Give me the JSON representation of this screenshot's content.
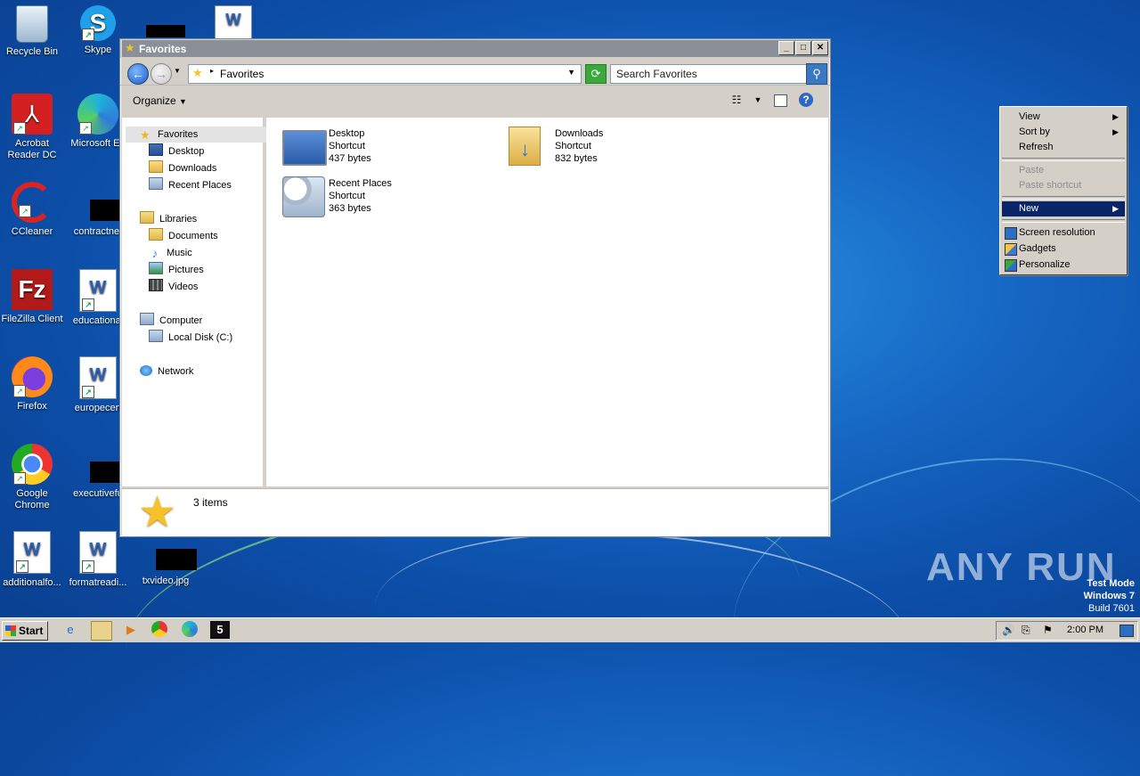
{
  "desktop": {
    "icons": [
      {
        "label": "Recycle Bin"
      },
      {
        "label": "Skype"
      },
      {
        "label": "Acrobat Reader DC"
      },
      {
        "label": "Microsoft Ed"
      },
      {
        "label": "CCleaner"
      },
      {
        "label": "contractnet"
      },
      {
        "label": "FileZilla Client"
      },
      {
        "label": "educational"
      },
      {
        "label": "Firefox"
      },
      {
        "label": "europecert"
      },
      {
        "label": "Google Chrome"
      },
      {
        "label": "executivefu"
      },
      {
        "label": "additionalfo..."
      },
      {
        "label": "formatreadi..."
      },
      {
        "label": "txvideo.jpg"
      }
    ]
  },
  "window": {
    "title": "Favorites",
    "address": "Favorites",
    "search_placeholder": "Search Favorites",
    "toolbar": {
      "organize": "Organize"
    },
    "nav": {
      "favorites": "Favorites",
      "desktop": "Desktop",
      "downloads": "Downloads",
      "recent_places": "Recent Places",
      "libraries": "Libraries",
      "documents": "Documents",
      "music": "Music",
      "pictures": "Pictures",
      "videos": "Videos",
      "computer": "Computer",
      "local_disk": "Local Disk (C:)",
      "network": "Network"
    },
    "files": [
      {
        "name": "Desktop",
        "type": "Shortcut",
        "size": "437 bytes"
      },
      {
        "name": "Downloads",
        "type": "Shortcut",
        "size": "832 bytes"
      },
      {
        "name": "Recent Places",
        "type": "Shortcut",
        "size": "363 bytes"
      }
    ],
    "status": {
      "count": "3 items"
    }
  },
  "context_menu": {
    "items": {
      "view": "View",
      "sort_by": "Sort by",
      "refresh": "Refresh",
      "paste": "Paste",
      "paste_shortcut": "Paste shortcut",
      "new": "New",
      "screen_resolution": "Screen resolution",
      "gadgets": "Gadgets",
      "personalize": "Personalize"
    }
  },
  "taskbar": {
    "start": "Start",
    "clock": "2:00 PM"
  },
  "watermark": {
    "brand": "ANY RUN",
    "test_mode": "Test Mode",
    "os": "Windows 7",
    "build": "Build 7601"
  },
  "colors": {
    "desktop_blue": "#1566c2",
    "menu_highlight": "#0a246a",
    "classic_gray": "#d4d0c8"
  }
}
